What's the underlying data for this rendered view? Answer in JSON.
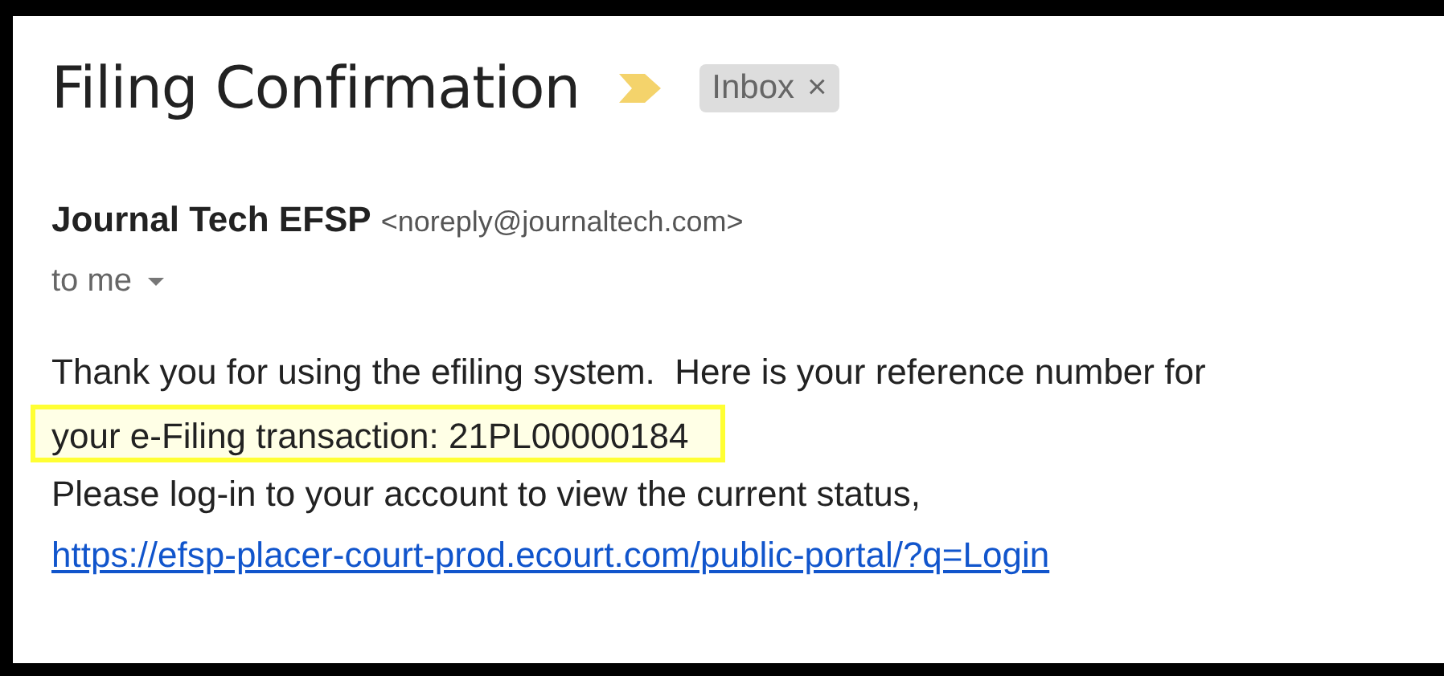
{
  "subject": "Filing Confirmation",
  "label": {
    "text": "Inbox",
    "close": "×"
  },
  "sender": {
    "name": "Journal Tech EFSP",
    "email": "<noreply@journaltech.com>"
  },
  "recipient": "to me",
  "body": [
    {
      "kind": "text",
      "text": "Thank you for using the efiling system.  Here is your reference number for"
    },
    {
      "kind": "highlight",
      "text": "your e-Filing transaction: 21PL00000184"
    },
    {
      "kind": "text",
      "text": "Please log-in to your account to view the current status,"
    },
    {
      "kind": "link",
      "text": "https://efsp-placer-court-prod.ecourt.com/public-portal/?q=Login"
    }
  ]
}
